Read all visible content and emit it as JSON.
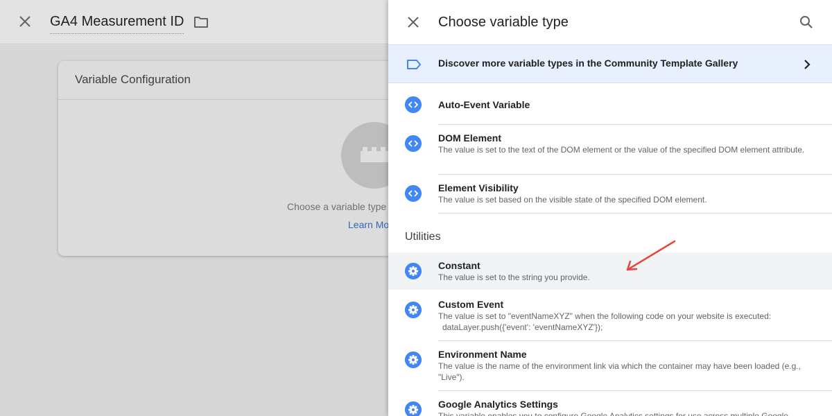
{
  "editor": {
    "title": "GA4 Measurement ID",
    "card_title": "Variable Configuration",
    "card_hint": "Choose a variable type",
    "card_link": "Learn Mo"
  },
  "drawer": {
    "title": "Choose variable type",
    "gallery_banner": "Discover more variable types in the Community Template Gallery",
    "section_utilities": "Utilities",
    "items": [
      {
        "name": "Auto-Event Variable",
        "desc": ""
      },
      {
        "name": "DOM Element",
        "desc": "The value is set to the text of the DOM element or the value of the specified DOM element attribute."
      },
      {
        "name": "Element Visibility",
        "desc": "The value is set based on the visible state of the specified DOM element."
      },
      {
        "name": "Constant",
        "desc": "The value is set to the string you provide."
      },
      {
        "name": "Custom Event",
        "desc": "The value is set to \"eventNameXYZ\" when the following code on your website is executed:",
        "code": "dataLayer.push({'event': 'eventNameXYZ'});"
      },
      {
        "name": "Environment Name",
        "desc": "The value is the name of the environment link via which the container may have been loaded (e.g., \"Live\")."
      },
      {
        "name": "Google Analytics Settings",
        "desc": "This variable enables you to configure Google Analytics settings for use across multiple Google"
      }
    ]
  },
  "colors": {
    "accent": "#4285f4",
    "banner_bg": "#e8f0fe",
    "highlight_row": "#f1f3f4",
    "annotation_arrow": "#e8453c"
  },
  "icons": {
    "close": "close-icon",
    "folder": "folder-icon",
    "search": "search-icon",
    "tag": "tag-outline-icon",
    "chevron": "chevron-right-icon",
    "code": "code-brackets-icon",
    "gear": "gear-icon"
  }
}
